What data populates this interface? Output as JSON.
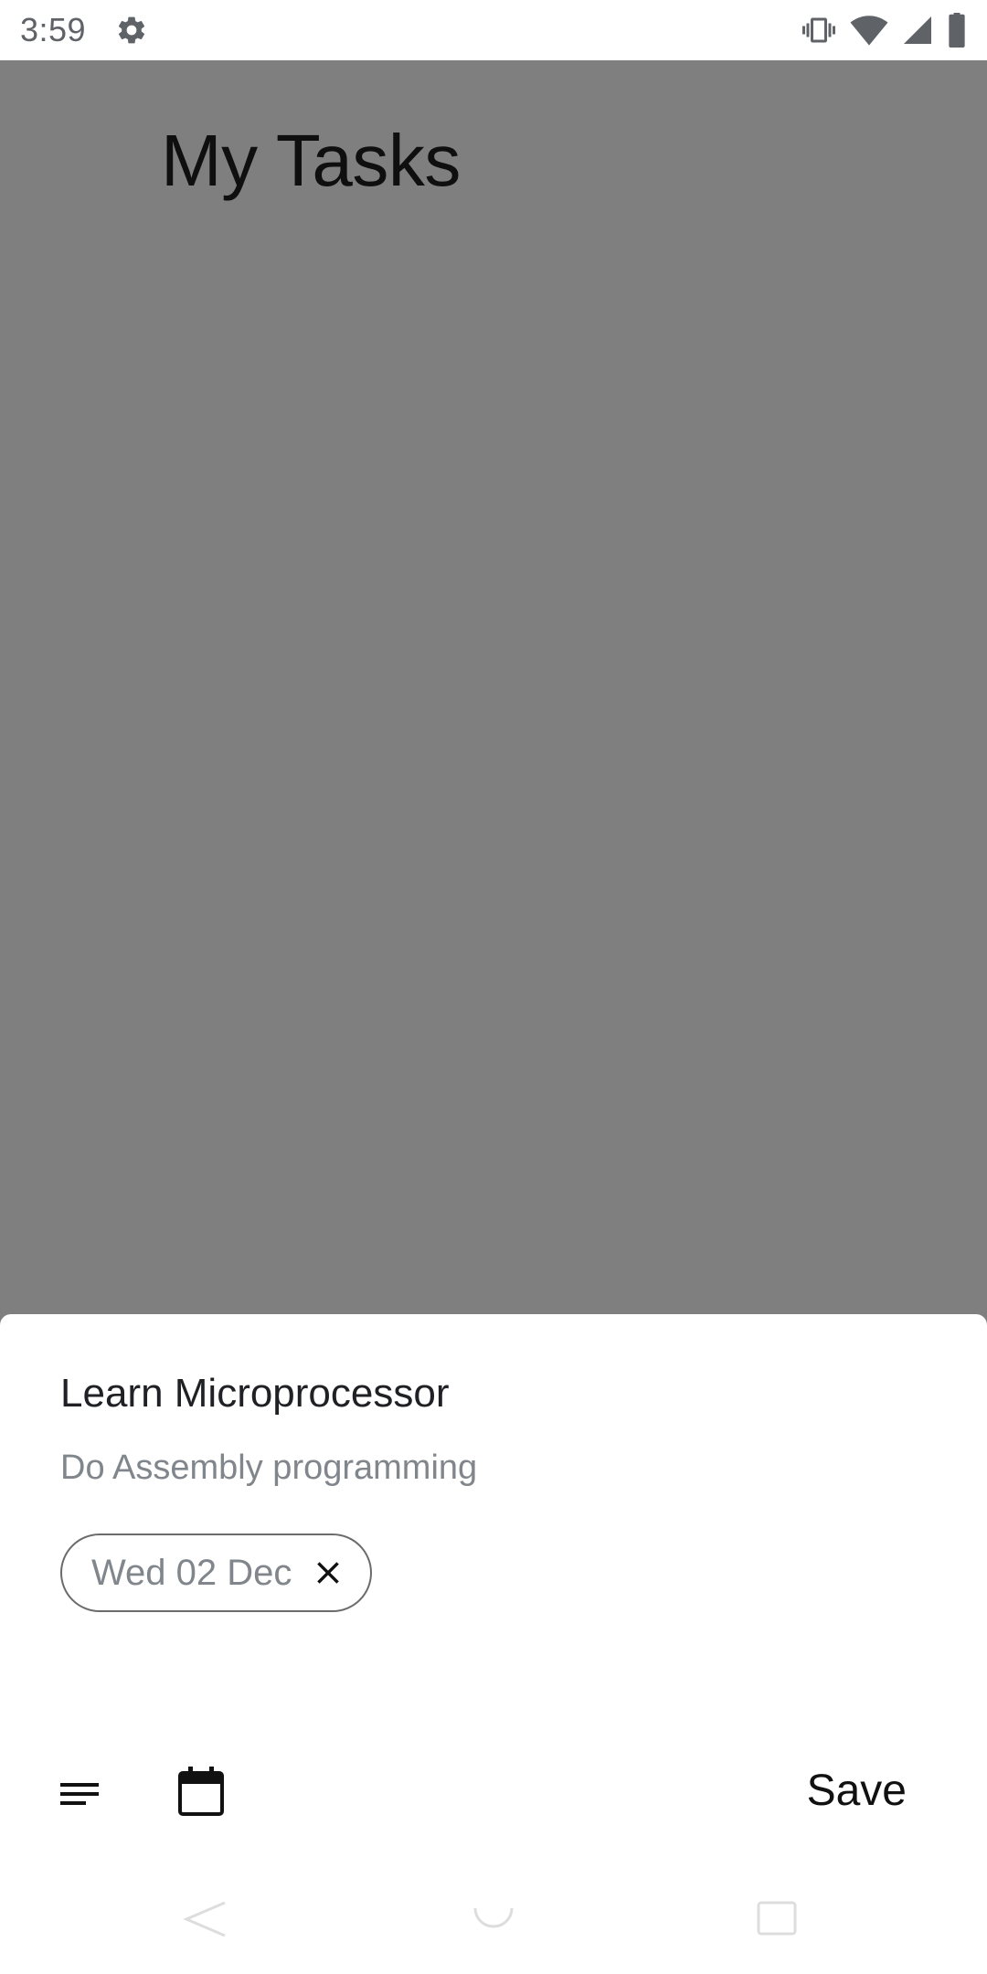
{
  "status_bar": {
    "time": "3:59",
    "icons": [
      "settings-icon",
      "vibrate-icon",
      "wifi-icon",
      "signal-icon",
      "battery-icon"
    ]
  },
  "page": {
    "title": "My Tasks"
  },
  "sheet": {
    "task_title": "Learn Microprocessor",
    "task_details": "Do Assembly programming",
    "due_date_chip": "Wed 02 Dec",
    "toolbar": {
      "details_icon": "short-text-icon",
      "date_icon": "calendar-icon",
      "save_label": "Save"
    }
  },
  "nav_bar": {
    "icons": [
      "back-icon",
      "home-icon",
      "recents-icon"
    ]
  },
  "colors": {
    "scrim": "#7f7f7f",
    "sheet": "#ffffff",
    "text_primary": "#202124",
    "text_secondary": "#80868b"
  }
}
